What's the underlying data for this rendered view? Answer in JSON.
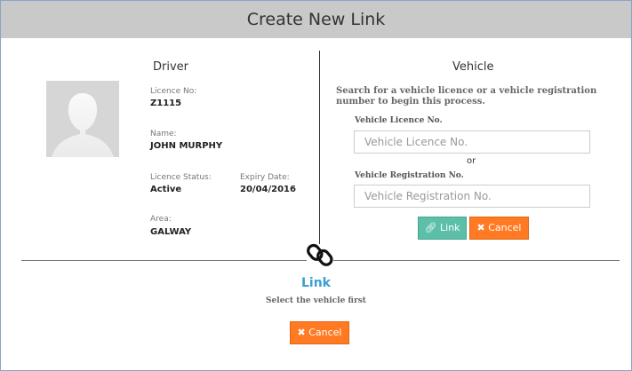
{
  "dialog": {
    "title": "Create New Link"
  },
  "driver": {
    "heading": "Driver",
    "licence_no_label": "Licence No:",
    "licence_no": "Z1115",
    "name_label": "Name:",
    "name": "JOHN MURPHY",
    "licence_status_label": "Licence Status:",
    "licence_status": "Active",
    "expiry_date_label": "Expiry Date:",
    "expiry_date": "20/04/2016",
    "area_label": "Area:",
    "area": "GALWAY"
  },
  "vehicle": {
    "heading": "Vehicle",
    "instructions": "Search for a vehicle licence or a vehicle registration number to begin this process.",
    "licence_label": "Vehicle Licence No.",
    "licence_placeholder": "Vehicle Licence No.",
    "or_text": "or",
    "registration_label": "Vehicle Registration No.",
    "registration_placeholder": "Vehicle Registration No.",
    "link_button": "Link",
    "cancel_button": "Cancel"
  },
  "link_section": {
    "heading": "Link",
    "subtext": "Select the vehicle first",
    "cancel_button": "Cancel"
  },
  "icons": {
    "avatar": "user-silhouette-icon",
    "chain": "chain-link-icon",
    "link_button_icon": "link-icon",
    "cancel_icon": "close-icon"
  },
  "colors": {
    "title_bar": "#c9c9c9",
    "link_button": "#5cc0a9",
    "cancel_button": "#ff7a22",
    "link_heading": "#3a9fd2"
  }
}
